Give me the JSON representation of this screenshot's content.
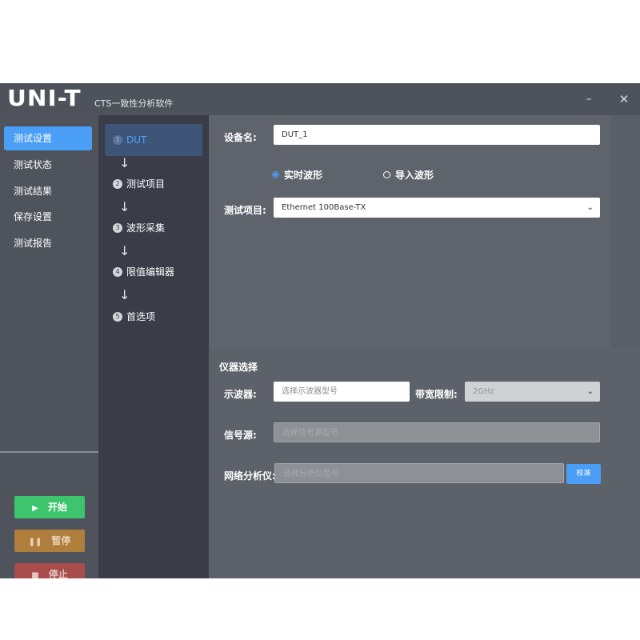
{
  "titlebar": {
    "logo": "UNI-T",
    "app_title": "CTS一致性分析软件",
    "minimize": "–",
    "close": "✕"
  },
  "nav": {
    "items": [
      {
        "label": "测试设置",
        "active": true
      },
      {
        "label": "测试状态",
        "active": false
      },
      {
        "label": "测试结果",
        "active": false
      },
      {
        "label": "保存设置",
        "active": false
      },
      {
        "label": "测试报告",
        "active": false
      }
    ],
    "start_label": "开始",
    "pause_label": "暂停",
    "stop_label": "停止"
  },
  "steps": [
    {
      "num": "1",
      "label": "DUT",
      "active": true
    },
    {
      "num": "2",
      "label": "测试项目",
      "active": false
    },
    {
      "num": "3",
      "label": "波形采集",
      "active": false
    },
    {
      "num": "4",
      "label": "限值编辑器",
      "active": false
    },
    {
      "num": "5",
      "label": "首选项",
      "active": false
    }
  ],
  "dut": {
    "device_name_label": "设备名:",
    "device_name_value": "DUT_1",
    "radio_realtime": "实时波形",
    "radio_import": "导入波形",
    "test_item_label": "测试项目:",
    "test_item_value": "Ethernet 100Base-TX"
  },
  "instruments": {
    "section_title": "仪器选择",
    "scope_label": "示波器:",
    "scope_placeholder": "选择示波器型号",
    "bandwidth_label": "带宽限制:",
    "bandwidth_value": "2GHz",
    "source_label": "信号源:",
    "source_placeholder": "选择信号源型号",
    "vna_label": "网络分析仪:",
    "vna_placeholder": "选择分析仪型号",
    "calibrate_label": "校准"
  },
  "colors": {
    "accent": "#4a9ef5",
    "start": "#3ec46d",
    "pause": "#b07e3c",
    "stop": "#a84c4c"
  }
}
